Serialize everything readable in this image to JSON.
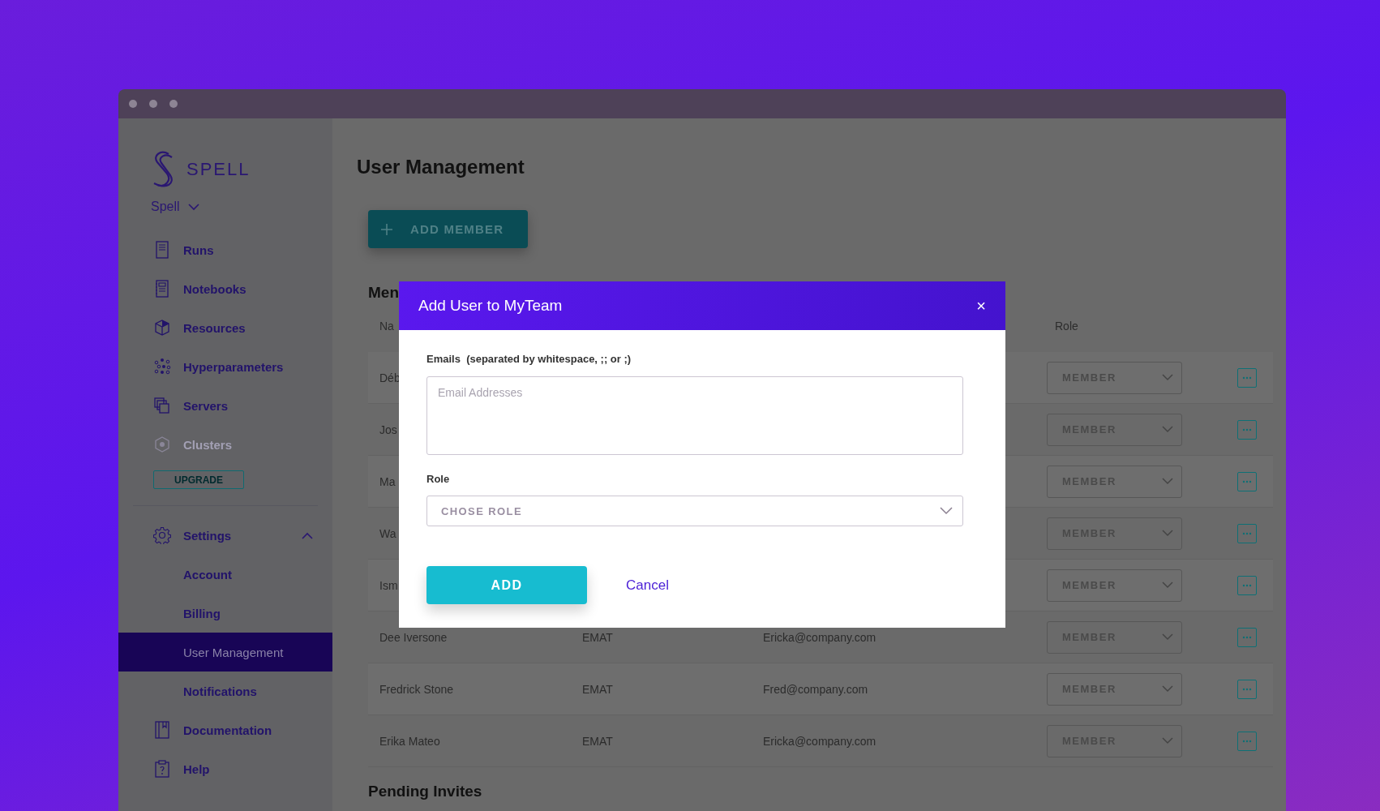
{
  "sidebar": {
    "logo": "SPELL",
    "workspace": "Spell",
    "items": [
      {
        "label": "Runs",
        "disabled": false
      },
      {
        "label": "Notebooks",
        "disabled": false
      },
      {
        "label": "Resources",
        "disabled": false
      },
      {
        "label": "Hyperparameters",
        "disabled": false
      },
      {
        "label": "Servers",
        "disabled": false
      },
      {
        "label": "Clusters",
        "disabled": true
      }
    ],
    "upgrade": "UPGRADE",
    "settings": {
      "label": "Settings",
      "expanded": true,
      "children": [
        {
          "label": "Account",
          "selected": false
        },
        {
          "label": "Billing",
          "selected": false
        },
        {
          "label": "User Management",
          "selected": true
        },
        {
          "label": "Notifications",
          "selected": false
        }
      ]
    },
    "bottom_items": [
      {
        "label": "Documentation"
      },
      {
        "label": "Help"
      }
    ]
  },
  "main": {
    "title": "User Management",
    "add_button": "ADD MEMBER",
    "members_heading": "Men",
    "table": {
      "columns": {
        "name": "Na",
        "role": "Role"
      },
      "rows": [
        {
          "name": "Déb",
          "role": "MEMBER"
        },
        {
          "name": "Jos",
          "role": "MEMBER"
        },
        {
          "name": "Ma",
          "role": "MEMBER"
        },
        {
          "name": "Wa",
          "role": "MEMBER"
        },
        {
          "name": "Ism",
          "role": "MEMBER"
        },
        {
          "name": "Dee Iversone",
          "team": "EMAT",
          "email": "Ericka@company.com",
          "role": "MEMBER"
        },
        {
          "name": "Fredrick Stone",
          "team": "EMAT",
          "email": "Fred@company.com",
          "role": "MEMBER"
        },
        {
          "name": "Erika Mateo",
          "team": "EMAT",
          "email": "Ericka@company.com",
          "role": "MEMBER"
        }
      ]
    },
    "pending_heading": "Pending Invites"
  },
  "modal": {
    "title": "Add User to MyTeam",
    "close": "×",
    "emails": {
      "label": "Emails  (separated by whitespace, ;; or ;)",
      "placeholder": "Email Addresses"
    },
    "role": {
      "label": "Role",
      "placeholder": "CHOSE ROLE"
    },
    "add": "ADD",
    "cancel": "Cancel"
  }
}
